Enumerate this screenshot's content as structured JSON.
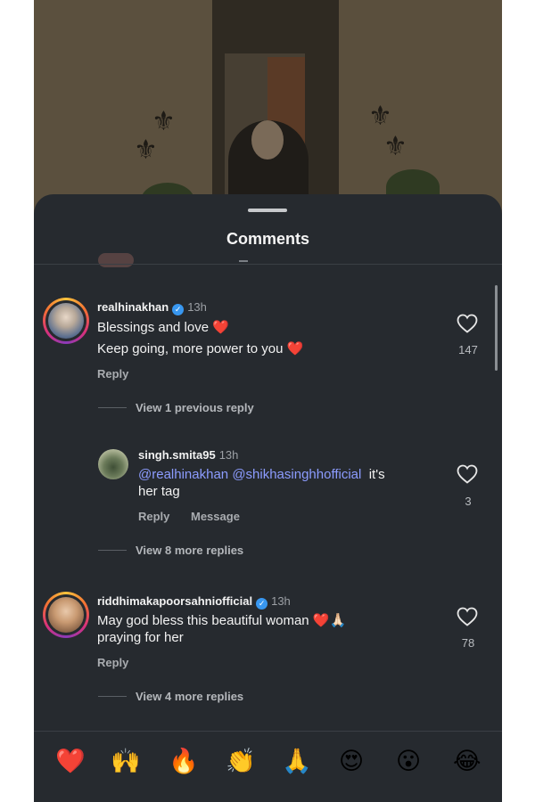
{
  "colors": {
    "sheet_bg": "#262a2f",
    "accent_mention": "#8c9cff",
    "verified_blue": "#3897f0",
    "heart_red": "#ed2b43"
  },
  "sheet": {
    "title": "Comments"
  },
  "comments": [
    {
      "username": "realhinakhan",
      "verified": true,
      "time": "13h",
      "lines": [
        "Blessings and love",
        "Keep going, more power to you"
      ],
      "likes": "147",
      "reply_label": "Reply",
      "view_replies": "View 1 previous reply",
      "avatar_icon": "profile-photo-icon"
    },
    {
      "username": "singh.smita95",
      "time": "13h",
      "mentions": [
        "@realhinakhan",
        "@shikhasinghhofficial"
      ],
      "text_after": "it's",
      "line2": "her tag",
      "likes": "3",
      "reply_label": "Reply",
      "message_label": "Message",
      "view_replies": "View 8 more replies"
    },
    {
      "username": "riddhimakapoorsahniofficial",
      "verified": true,
      "time": "13h",
      "line1": "May god bless this beautiful woman",
      "line2": "praying for her",
      "likes": "78",
      "reply_label": "Reply",
      "view_replies": "View 4 more replies"
    }
  ],
  "emoji_bar": [
    {
      "name": "red-heart",
      "glyph": "❤️"
    },
    {
      "name": "raising-hands",
      "glyph": "🙌"
    },
    {
      "name": "fire",
      "glyph": "🔥"
    },
    {
      "name": "clapping-hands",
      "glyph": "👏"
    },
    {
      "name": "folded-hands",
      "glyph": "🙏"
    },
    {
      "name": "heart-eyes",
      "glyph": "😍"
    },
    {
      "name": "surprised-face",
      "glyph": "😮"
    },
    {
      "name": "tears-of-joy",
      "glyph": "😂"
    }
  ],
  "inline_emoji": {
    "heart": "❤️",
    "pray": "🙏🏻"
  }
}
